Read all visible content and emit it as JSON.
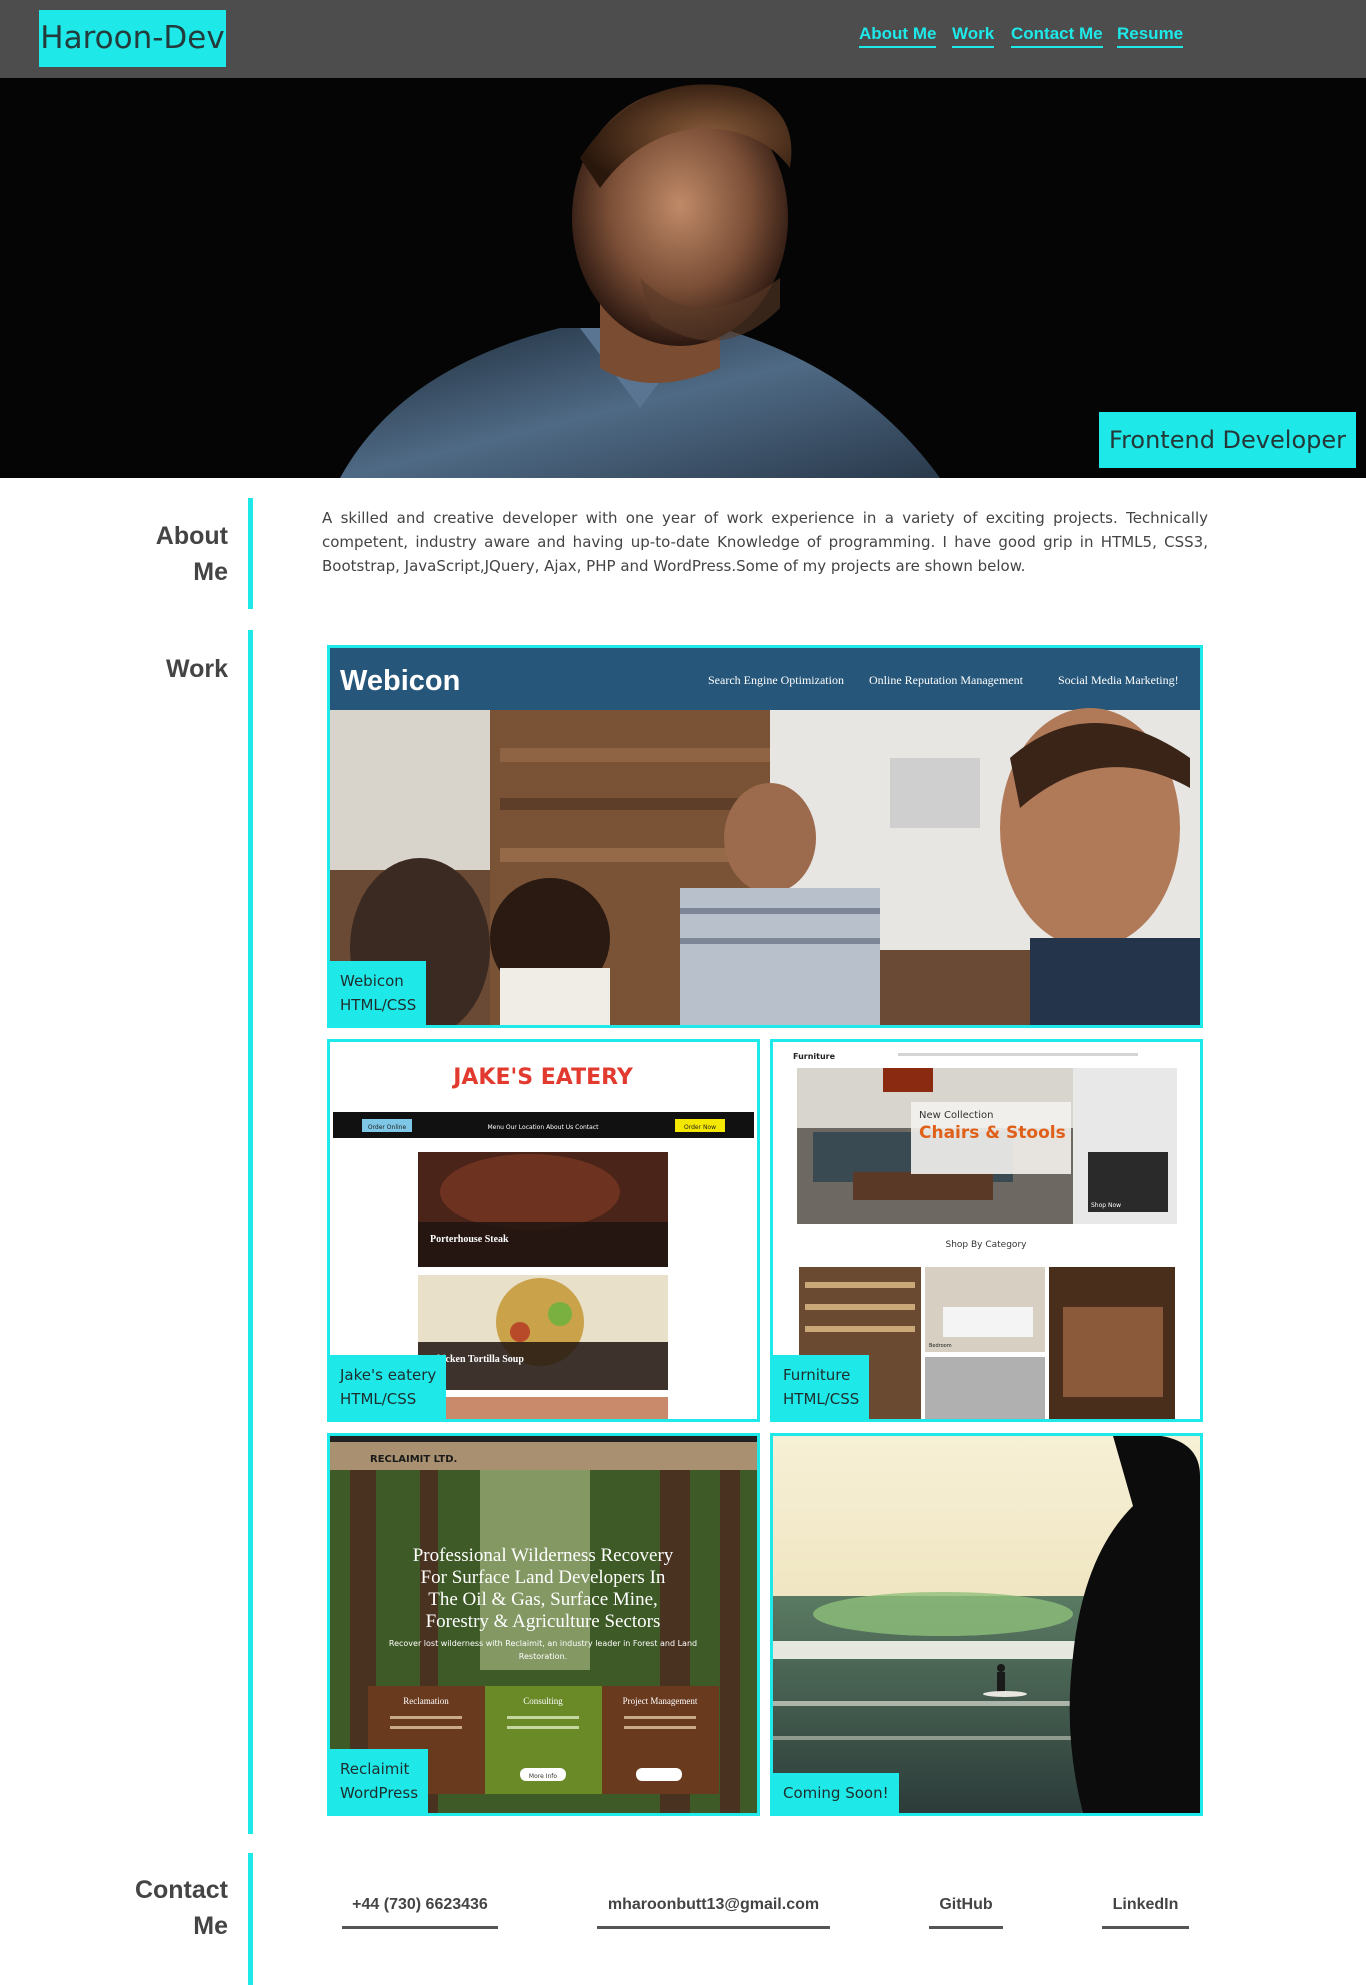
{
  "brand": {
    "name": "Haroon-Dev"
  },
  "nav": {
    "about": "About Me",
    "work": "Work",
    "contact": "Contact Me",
    "resume": "Resume"
  },
  "hero": {
    "badge": "Frontend Developer"
  },
  "about": {
    "title_line1": "About",
    "title_line2": "Me",
    "text": "A skilled and creative developer with one year of work experience in a variety of exciting projects. Technically competent, industry aware and having up-to-date Knowledge of programming. I have good grip in HTML5, CSS3, Bootstrap, JavaScript,JQuery, Ajax, PHP and WordPress.Some of my projects are shown below."
  },
  "work": {
    "title": "Work",
    "projects": [
      {
        "name": "Webicon",
        "tech": "HTML/CSS",
        "screen": {
          "logo": "Webicon",
          "nav": [
            "Search Engine Optimization",
            "Online Reputation Management",
            "Social Media Marketing!"
          ]
        }
      },
      {
        "name": "Jake's eatery",
        "tech": "HTML/CSS",
        "screen": {
          "logo": "JAKE'S EATERY",
          "order": "Order Online",
          "menu": "Menu  Our Location  About Us  Contact",
          "order2": "Order Now",
          "dish1": "Porterhouse Steak",
          "dish2": "Chicken Tortilla Soup"
        }
      },
      {
        "name": "Furniture",
        "tech": "HTML/CSS",
        "screen": {
          "logo": "Furniture",
          "new": "New Collection",
          "headline": "Chairs & Stools",
          "shop": "Shop Now",
          "category": "Shop By Category",
          "bedroom": "Bedroom"
        }
      },
      {
        "name": "Reclaimit",
        "tech": "WordPress",
        "screen": {
          "logo": "RECLAIMIT LTD.",
          "headline": [
            "Professional Wilderness Recovery",
            "For Surface Land Developers In",
            "The Oil & Gas, Surface Mine,",
            "Forestry & Agriculture Sectors"
          ],
          "sub": [
            "Recover lost wilderness with Reclaimit, an industry leader in Forest and Land",
            "Restoration."
          ],
          "cols": [
            "Reclamation",
            "Consulting",
            "Project Management"
          ],
          "btn": "More Info"
        }
      },
      {
        "name": "Coming Soon!",
        "tech": ""
      }
    ]
  },
  "contact": {
    "title_line1": "Contact",
    "title_line2": "Me",
    "phone": "+44 (730) 6623436",
    "email": "mharoonbutt13@gmail.com",
    "github": "GitHub",
    "linkedin": "LinkedIn"
  },
  "colors": {
    "accent": "#1ee8e8",
    "header": "#4d4d4d",
    "text": "#444444"
  }
}
